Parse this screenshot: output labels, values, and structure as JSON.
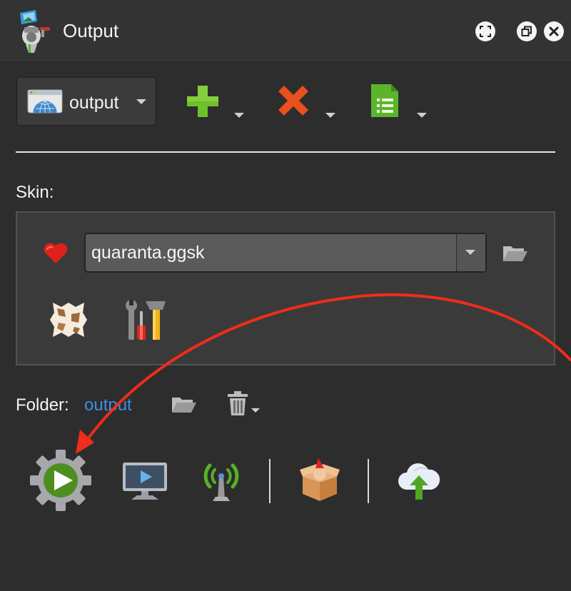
{
  "window": {
    "title": "Output",
    "app_icon": "ggskin-app-icon",
    "controls": [
      "fullscreen-icon",
      "restore-icon",
      "close-icon"
    ]
  },
  "toolbar": {
    "output_select": {
      "value": "output",
      "icon": "browser-globe-icon"
    },
    "add": {
      "icon": "plus-icon",
      "color": "#6fbf2a"
    },
    "delete": {
      "icon": "x-icon",
      "color": "#e8501e"
    },
    "settings": {
      "icon": "document-list-icon",
      "color": "#5bb52c"
    }
  },
  "skin": {
    "label": "Skin:",
    "favorite_icon": "heart-icon",
    "file_value": "quaranta.ggsk",
    "browse_icon": "folder-open-icon",
    "editor_icon": "cowhide-icon",
    "tools_icon": "tools-icon"
  },
  "folder": {
    "label": "Folder:",
    "link": "output",
    "browse_icon": "folder-open-icon",
    "trash_icon": "trash-icon"
  },
  "actions": [
    {
      "name": "generate",
      "icon": "play-gear-icon"
    },
    {
      "name": "preview",
      "icon": "monitor-play-icon"
    },
    {
      "name": "broadcast",
      "icon": "antenna-icon"
    },
    {
      "name": "package",
      "icon": "open-box-icon"
    },
    {
      "name": "upload",
      "icon": "cloud-upload-icon"
    }
  ],
  "colors": {
    "background": "#2e2e2e",
    "link": "#3d8fe0",
    "annotation_arrow": "#ee2d1a"
  }
}
